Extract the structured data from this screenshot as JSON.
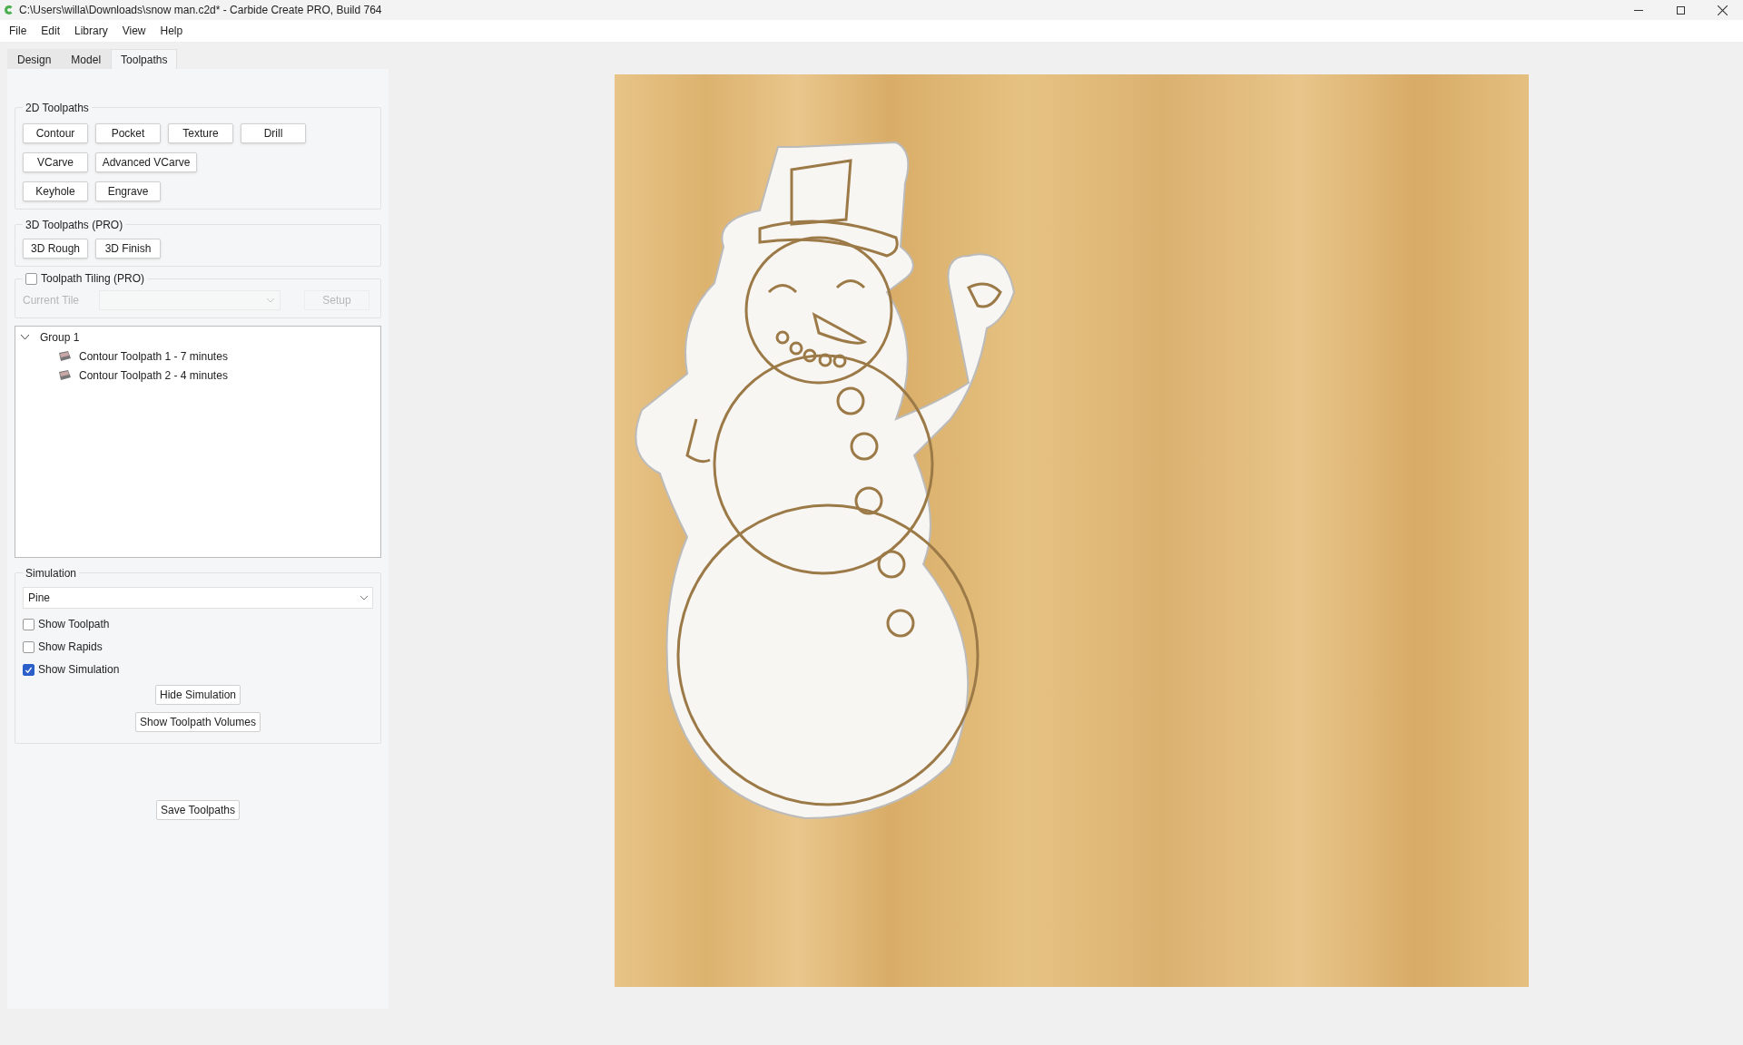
{
  "window": {
    "title": "C:\\Users\\willa\\Downloads\\snow man.c2d* - Carbide Create PRO, Build 764"
  },
  "menu": [
    "File",
    "Edit",
    "Library",
    "View",
    "Help"
  ],
  "tabs": [
    {
      "label": "Design",
      "selected": false
    },
    {
      "label": "Model",
      "selected": false
    },
    {
      "label": "Toolpaths",
      "selected": true
    }
  ],
  "toolpaths_2d": {
    "title": "2D Toolpaths",
    "rows": [
      [
        "Contour",
        "Pocket",
        "Texture",
        "Drill"
      ],
      [
        "VCarve",
        "Advanced VCarve"
      ],
      [
        "Keyhole",
        "Engrave"
      ]
    ]
  },
  "toolpaths_3d": {
    "title": "3D Toolpaths (PRO)",
    "buttons": [
      "3D Rough",
      "3D Finish"
    ]
  },
  "tiling": {
    "label": "Toolpath Tiling (PRO)",
    "checked": false,
    "current_tile_label": "Current Tile",
    "setup": "Setup",
    "disabled": true
  },
  "tree": [
    {
      "label": "Group 1",
      "expanded": true,
      "children": [
        {
          "label": "Contour Toolpath 1 - 7 minutes"
        },
        {
          "label": "Contour Toolpath 2 - 4 minutes"
        }
      ]
    }
  ],
  "simulation": {
    "title": "Simulation",
    "material": "Pine",
    "options": [
      {
        "label": "Show Toolpath",
        "checked": false
      },
      {
        "label": "Show Rapids",
        "checked": false
      },
      {
        "label": "Show Simulation",
        "checked": true
      }
    ],
    "buttons": [
      "Hide Simulation",
      "Show Toolpath Volumes"
    ]
  },
  "save_button": "Save Toolpaths"
}
